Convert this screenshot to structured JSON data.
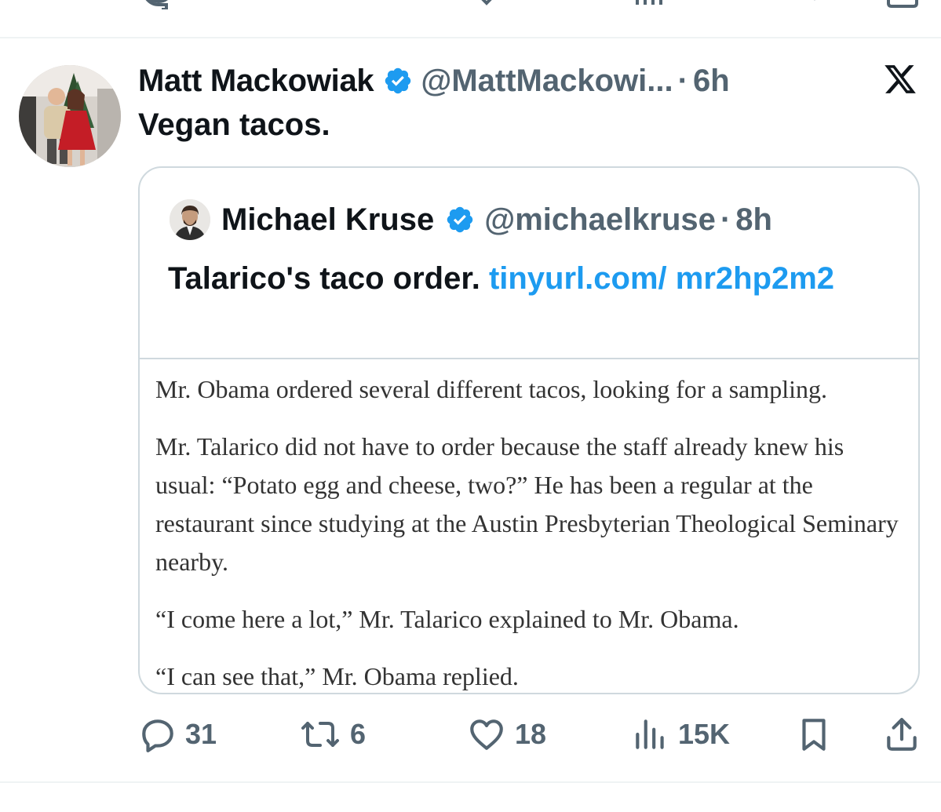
{
  "tweet": {
    "author_name": "Matt Mackowiak",
    "handle": "@MattMackowi...",
    "separator": "·",
    "time": "6h",
    "text": "Vegan tacos.",
    "avatar_icon": "user-photo-avatar",
    "platform_icon": "x-logo-icon"
  },
  "quoted": {
    "author_name": "Michael Kruse",
    "handle": "@michaelkruse",
    "separator": "·",
    "time": "8h",
    "text": "Talarico's taco order.",
    "link": "tinyurl.com/ mr2hp2m2",
    "excerpt": [
      "Mr. Obama ordered several different tacos, looking for a sampling.",
      "Mr. Talarico did not have to order because the staff already knew his usual: “Potato egg and cheese, two?” He has been a regular at the restaurant since studying at the Austin Presbyterian Theological Seminary nearby.",
      "“I come here a lot,” Mr. Talarico explained to Mr. Obama.",
      "“I can see that,” Mr. Obama replied."
    ]
  },
  "actions": {
    "replies": "31",
    "reposts": "6",
    "likes": "18",
    "views": "15K"
  },
  "colors": {
    "text": "#0f1419",
    "secondary": "#536471",
    "link": "#1d9bf0",
    "verified": "#1d9bf0",
    "border": "#cfd9de"
  }
}
